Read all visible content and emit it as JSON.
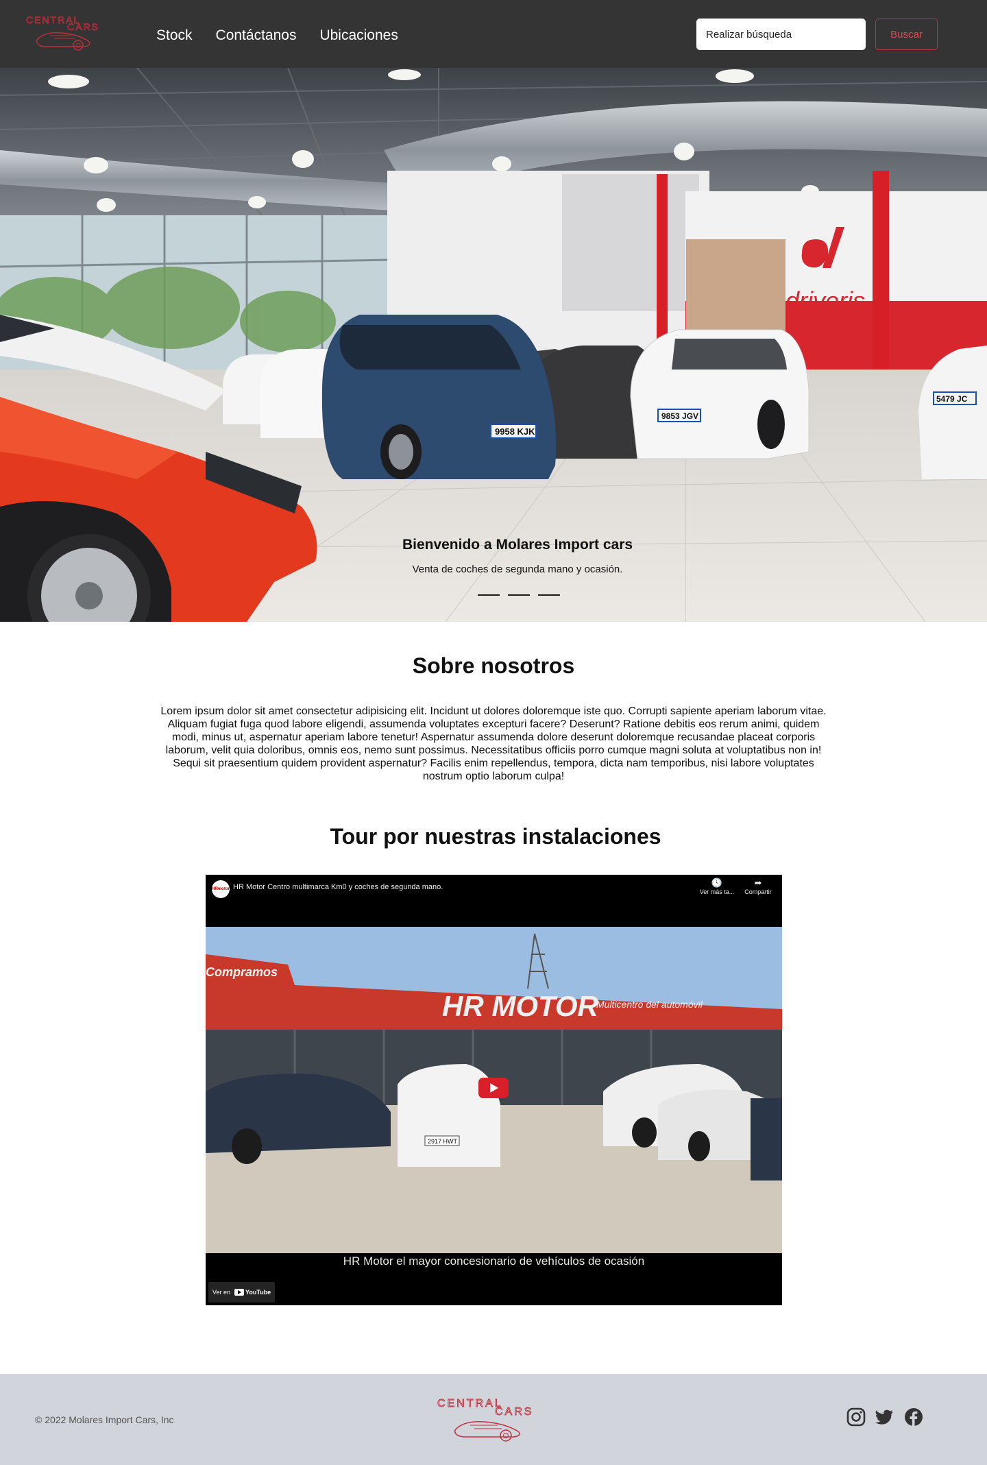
{
  "brand": {
    "logo_text_top": "CENTRAL",
    "logo_text_bottom": "CARS",
    "accent_color": "#c0303c"
  },
  "nav": {
    "links": [
      {
        "label": "Stock"
      },
      {
        "label": "Contáctanos"
      },
      {
        "label": "Ubicaciones"
      }
    ],
    "search_placeholder": "Realizar búsqueda",
    "search_button": "Buscar"
  },
  "hero": {
    "title": "Bienvenido a Molares Import cars",
    "subtitle": "Venta de coches de segunda mano y ocasión.",
    "slides": 3,
    "showroom_sign": "driveris",
    "plates": [
      "9958 KJK",
      "9853 JGV",
      "5479 JC"
    ]
  },
  "about": {
    "title": "Sobre nosotros",
    "text": "Lorem ipsum dolor sit amet consectetur adipisicing elit. Incidunt ut dolores doloremque iste quo. Corrupti sapiente aperiam laborum vitae. Aliquam fugiat fuga quod labore eligendi, assumenda voluptates excepturi facere? Deserunt? Ratione debitis eos rerum animi, quidem modi, minus ut, aspernatur aperiam labore tenetur! Aspernatur assumenda dolore deserunt doloremque recusandae placeat corporis laborum, velit quia doloribus, omnis eos, nemo sunt possimus. Necessitatibus officiis porro cumque magni soluta at voluptatibus non in! Sequi sit praesentium quidem provident aspernatur? Facilis enim repellendus, tempora, dicta nam temporibus, nisi labore voluptates nostrum optio laborum culpa!"
  },
  "tour": {
    "title": "Tour por nuestras instalaciones",
    "video_title": "HR Motor Centro multimarca Km0 y coches de segunda mano.",
    "channel_badge": "HRmotor",
    "watch_later": "Ver más ta...",
    "share": "Compartir",
    "building_sign": "HR MOTOR",
    "building_sign_sub": "Multicentro del automóvil",
    "left_sign": "Compramos",
    "caption": "HR Motor el mayor concesionario de vehículos de ocasión",
    "watch_on": "Ver en",
    "youtube": "YouTube",
    "plate": "2917 HWT"
  },
  "footer": {
    "copyright": "© 2022 Molares Import Cars, Inc",
    "social": [
      "instagram-icon",
      "twitter-icon",
      "facebook-icon"
    ],
    "background": "#d1d5db"
  }
}
